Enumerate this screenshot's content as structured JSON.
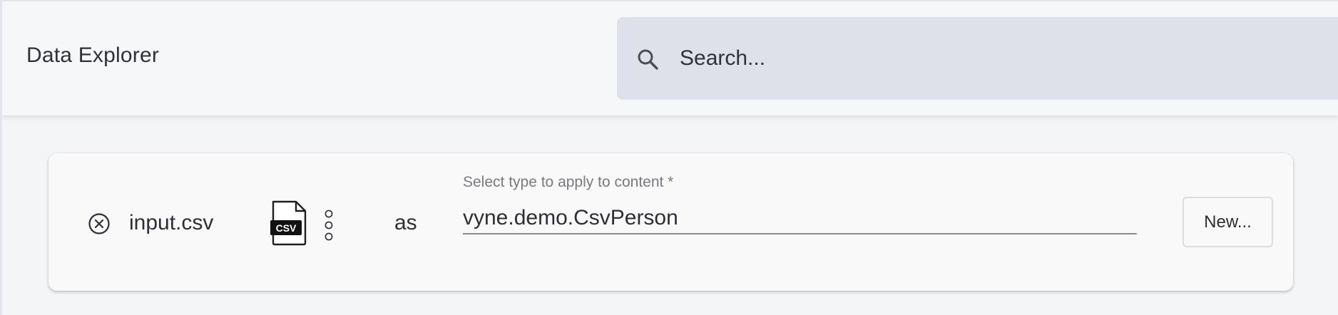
{
  "header": {
    "app_title": "Data Explorer",
    "search": {
      "placeholder": "Search...",
      "icon": "search-icon"
    }
  },
  "import_row": {
    "remove_icon": "close-circle-icon",
    "file_name": "input.csv",
    "file_icon": "csv-file-icon",
    "file_icon_text": "CSV",
    "more_icon": "more-vertical-icon",
    "as_label": "as",
    "type_field": {
      "label": "Select type to apply to content *",
      "value": "vyne.demo.CsvPerson"
    },
    "new_button_label": "New..."
  },
  "colors": {
    "header_background": "#f6f7f9",
    "search_background": "#dfe1ea",
    "card_background": "#f9f9f9",
    "page_background": "#f4f5f7",
    "text_primary": "#2c2f36",
    "text_secondary": "#777a80"
  }
}
